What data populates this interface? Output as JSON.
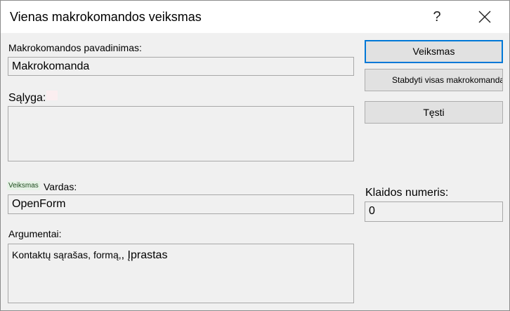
{
  "window": {
    "title": "Vienas makrokomandos veiksmas",
    "help_label": "?"
  },
  "macro_name": {
    "label": "Makrokomandos pavadinimas:",
    "value": "Makrokomanda"
  },
  "condition": {
    "label": "Sąlyga:",
    "value": ""
  },
  "action_name": {
    "hint": "Veiksmas",
    "label": "Vardas:",
    "value": "OpenForm"
  },
  "arguments": {
    "label": "Argumentai:",
    "value_main": "Kontaktų sąrašas, formą,",
    "value_suffix": ", Įprastas"
  },
  "error_number": {
    "label": "Klaidos numeris:",
    "value": "0"
  },
  "buttons": {
    "step": "Veiksmas",
    "stop_all": "Stabdyti visas makrokomandas",
    "continue": "Tęsti"
  }
}
